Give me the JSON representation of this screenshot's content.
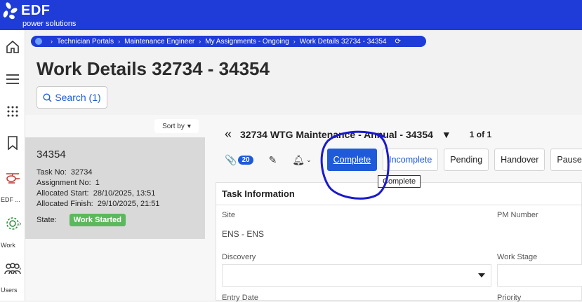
{
  "brand": {
    "name": "EDF",
    "tagline": "power solutions",
    "logo_icon": "edf-flower-logo",
    "color": "#1f3bd8"
  },
  "nav": {
    "items": [
      {
        "icon": "home-icon",
        "label": ""
      },
      {
        "icon": "menu-icon",
        "label": ""
      },
      {
        "icon": "apps-grid-icon",
        "label": ""
      },
      {
        "icon": "bookmark-icon",
        "label": ""
      },
      {
        "icon": "helicopter-icon",
        "label": "EDF ..."
      },
      {
        "icon": "gears-icon",
        "label": "Work"
      },
      {
        "icon": "users-icon",
        "label": "Users"
      }
    ]
  },
  "breadcrumb": {
    "items": [
      "Technician Portals",
      "Maintenance Engineer",
      "My Assignments - Ongoing",
      "Work Details 32734 - 34354"
    ],
    "refresh_icon": "refresh-icon"
  },
  "page": {
    "title": "Work Details 32734 - 34354"
  },
  "search": {
    "label": "Search (1)",
    "icon": "search-icon"
  },
  "list": {
    "sort_label": "Sort by",
    "card": {
      "title": "34354",
      "task_no_label": "Task No:",
      "task_no": "32734",
      "assignment_label": "Assignment No:",
      "assignment": "1",
      "start_label": "Allocated Start:",
      "start": "28/10/2025, 13:51",
      "finish_label": "Allocated Finish:",
      "finish": "29/10/2025, 21:51",
      "state_label": "State:",
      "state": "Work Started",
      "state_color": "#5cb85c"
    }
  },
  "detail": {
    "title": "32734 WTG Maintenance - Annual - 34354",
    "count": "1 of 1",
    "attachments": "20",
    "buttons": {
      "complete": "Complete",
      "incomplete": "Incomplete",
      "pending": "Pending",
      "handover": "Handover",
      "pause": "Pause"
    },
    "tooltip": "Complete",
    "section": "Task Information",
    "fields": {
      "site_label": "Site",
      "site_value": "ENS - ENS",
      "pm_label": "PM Number",
      "discovery_label": "Discovery",
      "stage_label": "Work Stage",
      "entry_label": "Entry Date",
      "priority_label": "Priority"
    }
  },
  "annotation": {
    "color": "#1a1acc"
  }
}
